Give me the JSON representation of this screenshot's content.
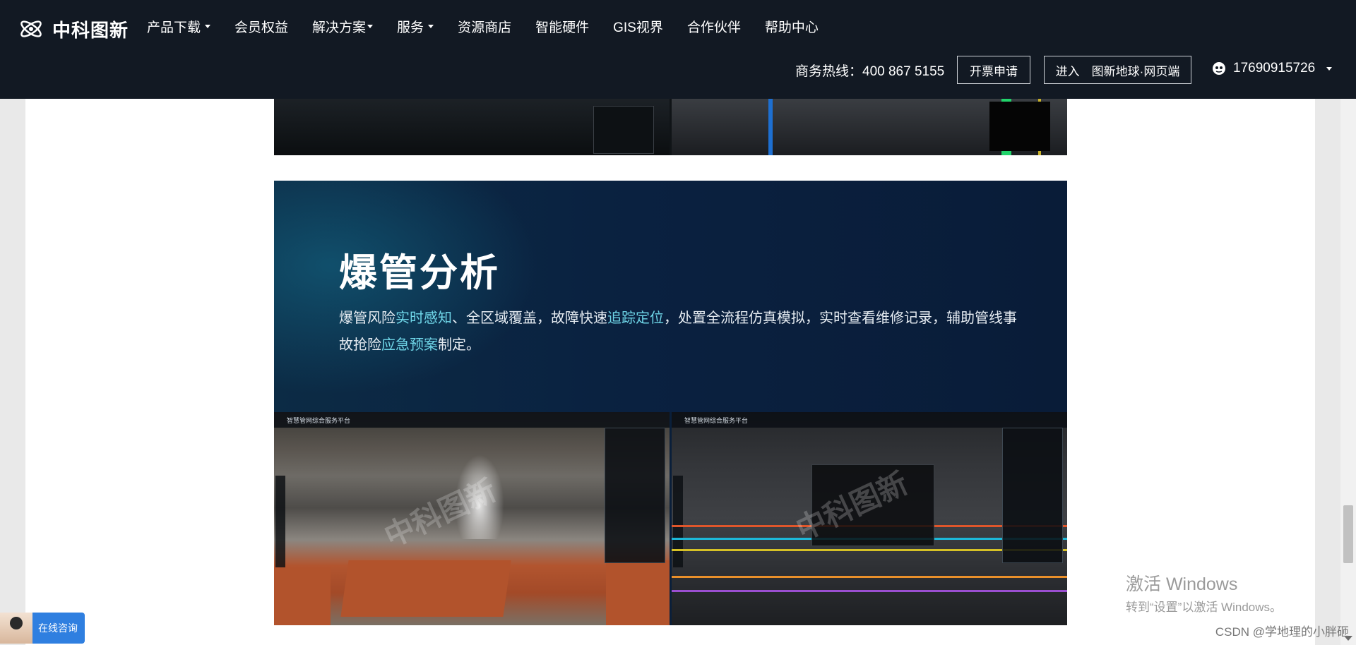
{
  "header": {
    "brand": "中科图新",
    "nav": [
      {
        "label": "产品下载",
        "dropdown": true
      },
      {
        "label": "会员权益",
        "dropdown": false
      },
      {
        "label": "解决方案",
        "dropdown": true
      },
      {
        "label": "服务",
        "dropdown": true
      },
      {
        "label": "资源商店",
        "dropdown": false
      },
      {
        "label": "智能硬件",
        "dropdown": false
      },
      {
        "label": "GIS视界",
        "dropdown": false
      },
      {
        "label": "合作伙伴",
        "dropdown": false
      },
      {
        "label": "帮助中心",
        "dropdown": false
      }
    ],
    "hotline": "商务热线：400 867 5155",
    "invoice_button": "开票申请",
    "enter_button": "进入　图新地球·网页端",
    "user_phone": "17690915726"
  },
  "feature": {
    "title": "爆管分析",
    "desc_part1": "爆管风险",
    "desc_hl1": "实时感知",
    "desc_part2": "、全区域覆盖，故障快速",
    "desc_hl2": "追踪定位",
    "desc_part3": "，处置全流程仿真模拟，实时查看维修记录，辅助管线事故抢险",
    "desc_hl3": "应急预案",
    "desc_part4": "制定。",
    "screenshot_title_left": "智慧管网综合服务平台",
    "screenshot_title_right": "智慧管网综合服务平台",
    "watermark": "中科图新"
  },
  "colors": {
    "header_bg": "#121923",
    "highlight": "#6fd6e8",
    "consult_bg": "#2f7fe0"
  },
  "windows_activation": {
    "title": "激活 Windows",
    "subtitle": "转到“设置”以激活 Windows。"
  },
  "csdn_watermark": "CSDN @学地理的小胖砸",
  "consult": {
    "label": "在线咨询"
  }
}
